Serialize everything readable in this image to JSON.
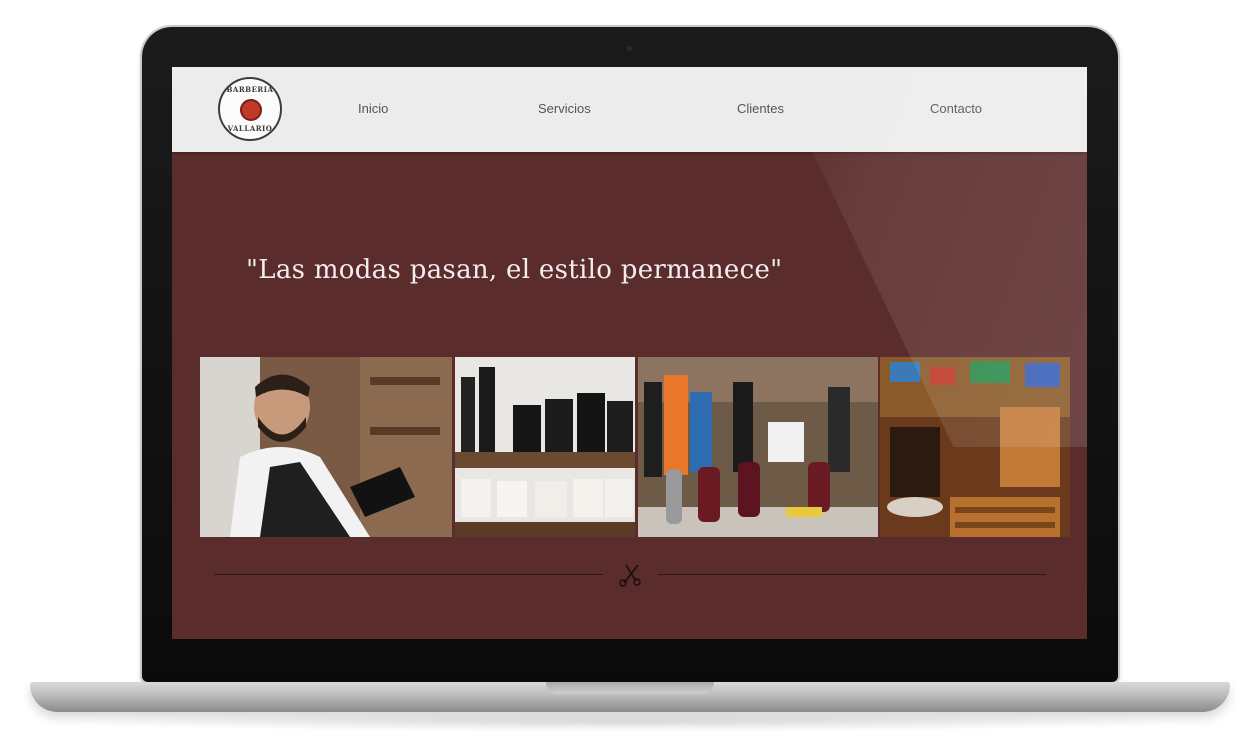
{
  "site": {
    "logo": {
      "top_text": "BARBERIA",
      "bottom_text": "VALLARIO",
      "icon": "barber-pole-emblem-icon"
    },
    "nav": [
      {
        "label": "Inicio"
      },
      {
        "label": "Servicios"
      },
      {
        "label": "Clientes"
      },
      {
        "label": "Contacto"
      }
    ],
    "hero": {
      "quote": "\"Las modas pasan,  el estilo permanece\""
    },
    "gallery": [
      {
        "name": "barber-portrait-photo"
      },
      {
        "name": "hair-products-shelf-photo"
      },
      {
        "name": "clippers-and-sprays-photo"
      },
      {
        "name": "barbershop-interior-photo"
      }
    ],
    "divider": {
      "icon": "scissors-icon"
    }
  },
  "colors": {
    "background": "#5b2c2c",
    "nav_background": "#ececec",
    "quote_text": "#f3ecec",
    "logo_red": "#c0392b"
  }
}
